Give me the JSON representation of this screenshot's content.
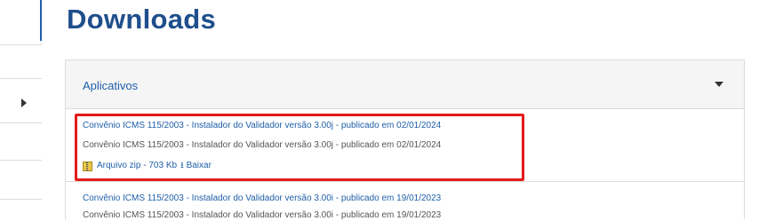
{
  "page": {
    "title": "Downloads"
  },
  "panel": {
    "label": "Aplicativos"
  },
  "items": [
    {
      "link": "Convênio ICMS 115/2003 - Instalador do Validador versão 3.00j - publicado em 02/01/2024",
      "desc": "Convênio ICMS 115/2003 - Instalador do Validador versão 3.00j - publicado em 02/01/2024",
      "file_label": "Arquivo zip - 703 Kb",
      "download_label": "Baixar"
    },
    {
      "link": "Convênio ICMS 115/2003 - Instalador do Validador versão 3.00i - publicado em 19/01/2023",
      "desc": "Convênio ICMS 115/2003 - Instalador do Validador versão 3.00i - publicado em 19/01/2023"
    }
  ],
  "colors": {
    "link": "#1f5fa8",
    "title": "#1f4e8c",
    "highlight": "#e41b1b"
  }
}
